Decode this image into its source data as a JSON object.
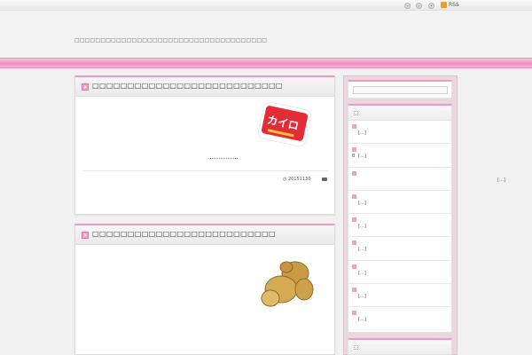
{
  "topbar": {
    "icons": [
      "arrow-left-icon",
      "arrow-right-icon",
      "bookmark-icon"
    ],
    "rss_label": "RSS"
  },
  "header": {
    "tagline": "□□□□□□□□□□□□□□□□□□□□□□□□□□□□□□□□□□□□□"
  },
  "posts": [
    {
      "title": "□□□□□□□□□□□□□□□□□□□□□□□□□□□",
      "image_label": "カイロ",
      "date": "20151130"
    },
    {
      "title": "□□□□□□□□□□□□□□□□□□□□□□□□□□"
    }
  ],
  "sidebar": {
    "search_placeholder": "",
    "widget_items": [
      {
        "prefix": "",
        "text": "[…]"
      },
      {
        "prefix": "B",
        "text": "[…]"
      },
      {
        "prefix": "",
        "text": ""
      },
      {
        "prefix": "",
        "text": "[…]"
      },
      {
        "prefix": "",
        "text": "[…]"
      },
      {
        "prefix": "",
        "text": "[…]"
      },
      {
        "prefix": "",
        "text": "[…]"
      },
      {
        "prefix": "",
        "text": "[…]"
      },
      {
        "prefix": "",
        "text": "[…]"
      }
    ]
  },
  "right_ellipsis": "[…]",
  "colors": {
    "accent_pink": "#f298c4",
    "pinkbar": "#ee8fbf",
    "sidebar_bg": "#ead6de"
  }
}
